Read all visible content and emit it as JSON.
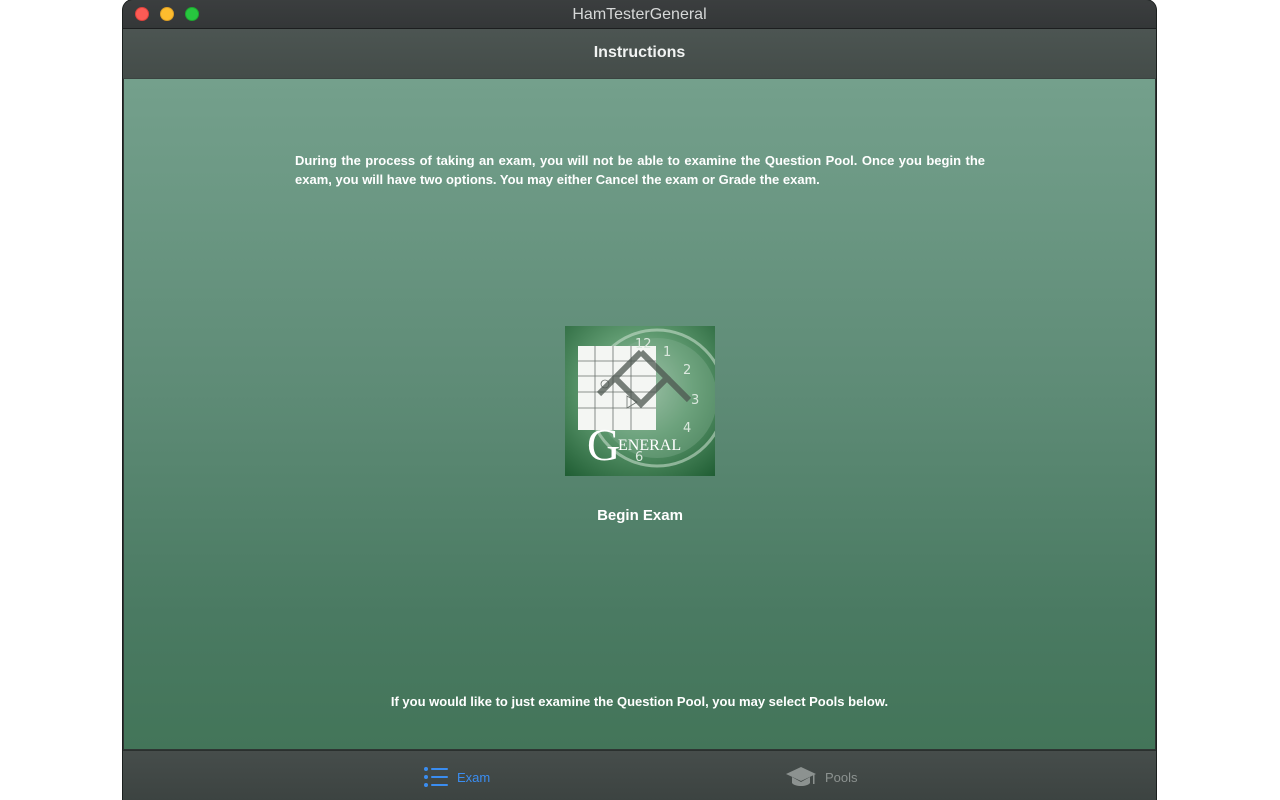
{
  "window": {
    "title": "HamTesterGeneral"
  },
  "navbar": {
    "title": "Instructions"
  },
  "main": {
    "instructions": "During the process of taking an exam, you will not be able to examine the Question Pool. Once you begin the exam, you will have two options. You may either Cancel the exam or Grade the exam.",
    "logo": {
      "icon": "general-license-logo",
      "text_initial": "G",
      "text_rest": "ENERAL"
    },
    "begin_label": "Begin Exam",
    "footer_note": "If you would like to just examine the Question Pool, you may select Pools below."
  },
  "tabbar": {
    "tabs": [
      {
        "label": "Exam",
        "icon": "list-icon",
        "selected": true
      },
      {
        "label": "Pools",
        "icon": "graduation-cap-icon",
        "selected": false
      }
    ]
  },
  "colors": {
    "accent": "#3a8df1",
    "content_top": "#74a08c",
    "content_bottom": "#437559",
    "close": "#fd5b55",
    "minimize": "#fdbc2e",
    "zoom": "#27c63f"
  }
}
